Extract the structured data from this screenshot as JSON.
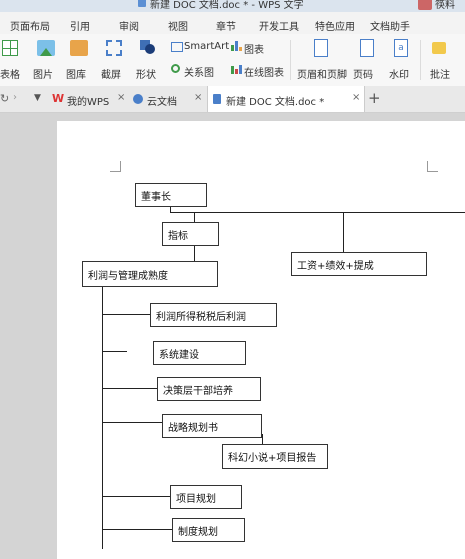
{
  "titlebar": {
    "doc_title": "新建 DOC 文档.doc * - WPS 文字",
    "username": "筷料"
  },
  "ribbon_tabs": [
    "页面布局",
    "引用",
    "审阅",
    "视图",
    "章节",
    "开发工具",
    "特色应用",
    "文档助手"
  ],
  "toolbar": {
    "table": "表格",
    "picture": "图片",
    "gallery": "图库",
    "screenshot": "截屏",
    "shape": "形状",
    "smartart": "SmartArt",
    "chart": "图表",
    "relation": "关系图",
    "online_chart": "在线图表",
    "header_footer": "页眉和页脚",
    "page_number": "页码",
    "watermark": "水印",
    "comment": "批注"
  },
  "doc_tabs": {
    "my_wps": "我的WPS",
    "cloud": "云文档",
    "new_doc": "新建 DOC 文档.doc *"
  },
  "diagram": {
    "chairman": "董事长",
    "indicator": "指标",
    "salary": "工资+绩效+提成",
    "profit_mgmt": "利润与管理成熟度",
    "items": {
      "profit": "利润所得税税后利润",
      "system": "系统建设",
      "decision": "决策层干部培养",
      "strategy": "战略规划书",
      "scifi": "科幻小说+项目报告",
      "project": "项目规划",
      "rules": "制度规划"
    }
  }
}
